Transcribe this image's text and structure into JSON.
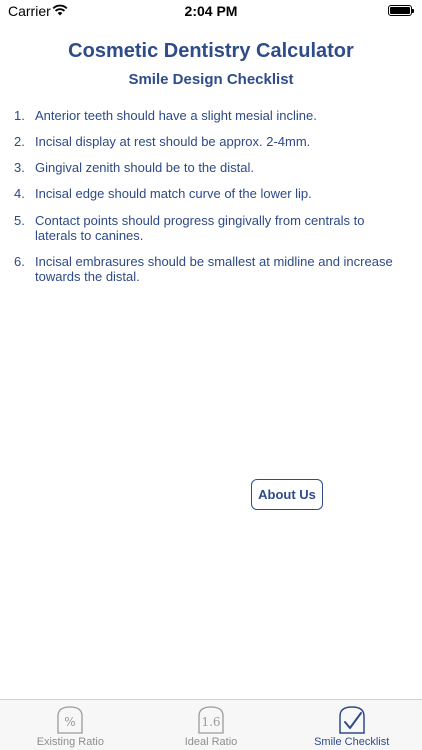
{
  "status_bar": {
    "carrier": "Carrier",
    "time": "2:04 PM"
  },
  "header": {
    "title": "Cosmetic Dentistry Calculator",
    "subtitle": "Smile Design Checklist"
  },
  "checklist": [
    {
      "num": "1.",
      "text": "Anterior teeth should have a slight mesial incline."
    },
    {
      "num": "2.",
      "text": "Incisal display at rest should be approx. 2-4mm."
    },
    {
      "num": "3.",
      "text": "Gingival zenith should be to the distal."
    },
    {
      "num": "4.",
      "text": "Incisal edge should match curve of the lower lip."
    },
    {
      "num": "5.",
      "text": "Contact points should progress gingivally from centrals to laterals to canines."
    },
    {
      "num": "6.",
      "text": "Incisal embrasures should be smallest at midline and increase towards the distal."
    }
  ],
  "about_button": {
    "label": "About Us"
  },
  "tabs": [
    {
      "label": "Existing Ratio",
      "icon": "percent-icon",
      "icon_text": "%",
      "active": false
    },
    {
      "label": "Ideal Ratio",
      "icon": "ratio-icon",
      "icon_text": "1.6",
      "active": false
    },
    {
      "label": "Smile Checklist",
      "icon": "checkmark-icon",
      "active": true
    }
  ],
  "colors": {
    "accent": "#2e4c8a",
    "inactive": "#8e8e93",
    "tab_bar_bg": "#f7f7f7"
  }
}
